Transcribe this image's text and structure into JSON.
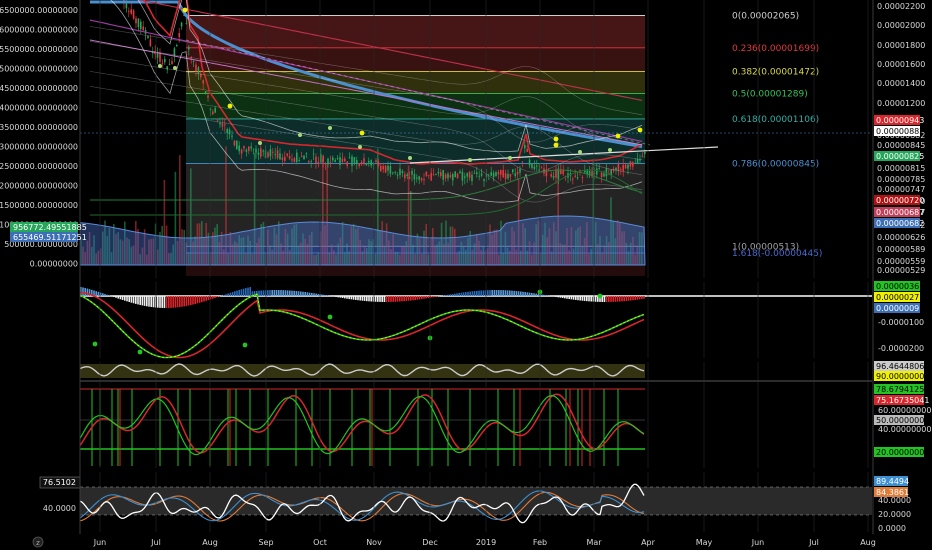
{
  "colors": {
    "background": "#000000",
    "axis_text": "#d8d8d8",
    "grid": "#2a2a2a",
    "price_up": "#26a65b",
    "price_down": "#e0393e",
    "fib_line": "#cfcfcf",
    "ma_blue": "#4a8fd0",
    "ma_red": "#d8262c",
    "ema_white": "#ffffff"
  },
  "main_panel": {
    "volume_axis_labels": [
      "6500000.00000000",
      "6000000.00000000",
      "5500000.00000000",
      "5000000.00000000",
      "4500000.00000000",
      "4000000.00000000",
      "3500000.00000000",
      "3000000.00000000",
      "2500000.00000000",
      "2000000.00000000",
      "1500000.00000000",
      "1000000.00000000",
      "500000.00000000",
      "0.00000000"
    ],
    "volume_badges": [
      {
        "text": "956772.49551885",
        "color": "#26a65b"
      },
      {
        "text": "655469.51171251",
        "color": "#3c6fb5"
      }
    ],
    "price_axis_labels": [
      "0.00002200",
      "0.00002000",
      "0.00001800",
      "0.00001600",
      "0.00001400",
      "0.00001200",
      "0.00000882",
      "0.00000845",
      "0.00000815",
      "0.00000785",
      "0.00000747",
      "0.00000720",
      "0.00000687",
      "0.00000682",
      "0.00000626",
      "0.00000589",
      "0.00000559",
      "0.00000529"
    ],
    "price_badges": [
      {
        "text": "0.00000943",
        "color": "#d8262c",
        "fg": "#ffffff"
      },
      {
        "text": "0.00000825",
        "color": "#26a65b",
        "fg": "#ffffff"
      },
      {
        "text": "0.00000720",
        "color": "#b01010",
        "fg": "#ffffff"
      },
      {
        "text": "0.00000687",
        "color": "#c0405a",
        "fg": "#ffffff"
      },
      {
        "text": "0.00000682",
        "color": "#3c6fb5",
        "fg": "#ffffff"
      }
    ],
    "fib_levels": [
      {
        "ratio": "0",
        "label": "0(0.00002065)",
        "color": "#cfcfcf"
      },
      {
        "ratio": "0.236",
        "label": "0.236(0.00001699)",
        "color": "#e0393e"
      },
      {
        "ratio": "0.382",
        "label": "0.382(0.00001472)",
        "color": "#d8d84a"
      },
      {
        "ratio": "0.5",
        "label": "0.5(0.00001289)",
        "color": "#36c25a"
      },
      {
        "ratio": "0.618",
        "label": "0.618(0.00001106)",
        "color": "#2fb0a8"
      },
      {
        "ratio": "0.786",
        "label": "0.786(0.00000845)",
        "color": "#4a90d0"
      },
      {
        "ratio": "1",
        "label": "1(0.00000513)",
        "color": "#a0a0a0"
      },
      {
        "ratio": "1.618",
        "label": "1.618(-0.00000445)",
        "color": "#4a6ad0"
      }
    ]
  },
  "macd_panel": {
    "axis_labels": [
      "-0.0000100",
      "-0.0000200"
    ],
    "badges": [
      {
        "text": "0.0000036",
        "color": "#22c322",
        "fg": "#000000"
      },
      {
        "text": "0.0000027",
        "color": "#f0f000",
        "fg": "#000000"
      },
      {
        "text": "0.0000009",
        "color": "#3c6fb5",
        "fg": "#ffffff"
      }
    ]
  },
  "stoch_panel": {
    "axis_labels": [
      "60.00000000",
      "40.00000000"
    ],
    "badges": [
      {
        "text": "96.46448061",
        "color": "#cccccc",
        "fg": "#000000"
      },
      {
        "text": "90.00000000",
        "color": "#f0f000",
        "fg": "#000000"
      },
      {
        "text": "78.67941254",
        "color": "#22c322",
        "fg": "#000000"
      },
      {
        "text": "75.16735041",
        "color": "#d8262c",
        "fg": "#ffffff"
      },
      {
        "text": "50.00000000",
        "color": "#bbbbbb",
        "fg": "#000000"
      },
      {
        "text": "20.00000000",
        "color": "#22c322",
        "fg": "#000000"
      }
    ]
  },
  "rsi_panel": {
    "left_labels": [
      "76.5102",
      "40.0000"
    ],
    "axis_labels": [
      "40.0000",
      "20.0000",
      "0.0000"
    ],
    "badges": [
      {
        "text": "89.4494",
        "color": "#3c8fd0",
        "fg": "#ffffff"
      },
      {
        "text": "84.3861",
        "color": "#e07b39",
        "fg": "#ffffff"
      }
    ]
  },
  "time_axis": {
    "labels": [
      "Jun",
      "Jul",
      "Aug",
      "Sep",
      "Oct",
      "Nov",
      "Dec",
      "2019",
      "Feb",
      "Mar",
      "Apr",
      "May",
      "Jun",
      "Jul",
      "Aug"
    ],
    "corner_icon": "z-icon"
  },
  "chart_data": {
    "type": "line",
    "title": "",
    "xlabel": "",
    "ylabel": "",
    "x": [
      "Jun",
      "Jul",
      "Aug",
      "Sep",
      "Oct",
      "Nov",
      "Dec",
      "2019",
      "Feb",
      "Mar",
      "Apr"
    ],
    "series": [
      {
        "values": [
          2.3e-05,
          1.8e-05,
          1.25e-05,
          9.2e-06,
          9e-06,
          8.2e-06,
          7.8e-06,
          8e-06,
          8.3e-06,
          8.2e-06,
          8.9e-06
        ]
      }
    ],
    "ylim": [
      4.5e-06,
      2.2e-05
    ],
    "fib_retracement_top": 2.065e-05,
    "fib_retracement_bottom": 5.13e-06,
    "log_scale": true
  }
}
